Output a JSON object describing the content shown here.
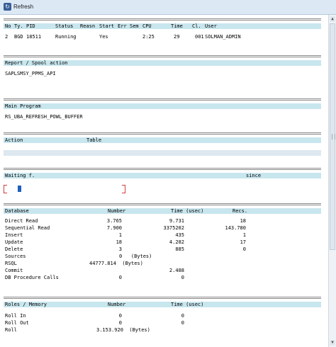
{
  "toolbar": {
    "refresh_label": "Refresh"
  },
  "process": {
    "headers": [
      "No",
      "Ty.",
      "PID",
      "Status",
      "Reasn",
      "Start",
      "Err",
      "Sem",
      "CPU",
      "Time",
      "Cl.",
      "User"
    ],
    "row": {
      "no": "2",
      "ty": "BGD",
      "pid": "18511",
      "status": "Running",
      "start": "Yes",
      "cpu": "2:25",
      "time": "29",
      "cl": "001",
      "user": "SOLMAN_ADMIN"
    }
  },
  "report": {
    "header": "Report / Spool action",
    "value": "SAPLSMSY_PPMS_API"
  },
  "main_program": {
    "header": "Main Program",
    "value": "RS_UBA_REFRESH_POWL_BUFFER"
  },
  "action": {
    "col_action": "Action",
    "col_table": "Table"
  },
  "waiting": {
    "col_waiting": "Waiting f.",
    "col_since": "since"
  },
  "database": {
    "headers": {
      "name": "Database",
      "number": "Number",
      "time": "Time (usec)",
      "recs": "Recs."
    },
    "rows": [
      {
        "name": "Direct Read",
        "number": "3.765",
        "time": "9.731",
        "recs": "18"
      },
      {
        "name": "Sequential Read",
        "number": "7.900",
        "time": "3375202",
        "recs": "143.780"
      },
      {
        "name": "Insert",
        "number": "1",
        "time": "435",
        "recs": "1"
      },
      {
        "name": "Update",
        "number": "18",
        "time": "4.282",
        "recs": "17"
      },
      {
        "name": "Delete",
        "number": "3",
        "time": "885",
        "recs": "0"
      },
      {
        "name": "Sources",
        "number": "0   (Bytes)",
        "time": "",
        "recs": ""
      },
      {
        "name": "RSQL",
        "number": "44777.814  (Bytes)",
        "time": "",
        "recs": ""
      },
      {
        "name": "Commit",
        "number": "",
        "time": "2.488",
        "recs": ""
      },
      {
        "name": "DB Procedure Calls",
        "number": "0",
        "time": "0",
        "recs": ""
      }
    ]
  },
  "roles": {
    "headers": {
      "name": "Roles / Memory",
      "number": "Number",
      "time": "Time (usec)"
    },
    "rows": [
      {
        "name": "Roll In",
        "number": "0",
        "time": "0"
      },
      {
        "name": "Roll Out",
        "number": "0",
        "time": "0"
      },
      {
        "name": "Roll",
        "number": "3.153.920  (Bytes)",
        "time": ""
      }
    ]
  }
}
